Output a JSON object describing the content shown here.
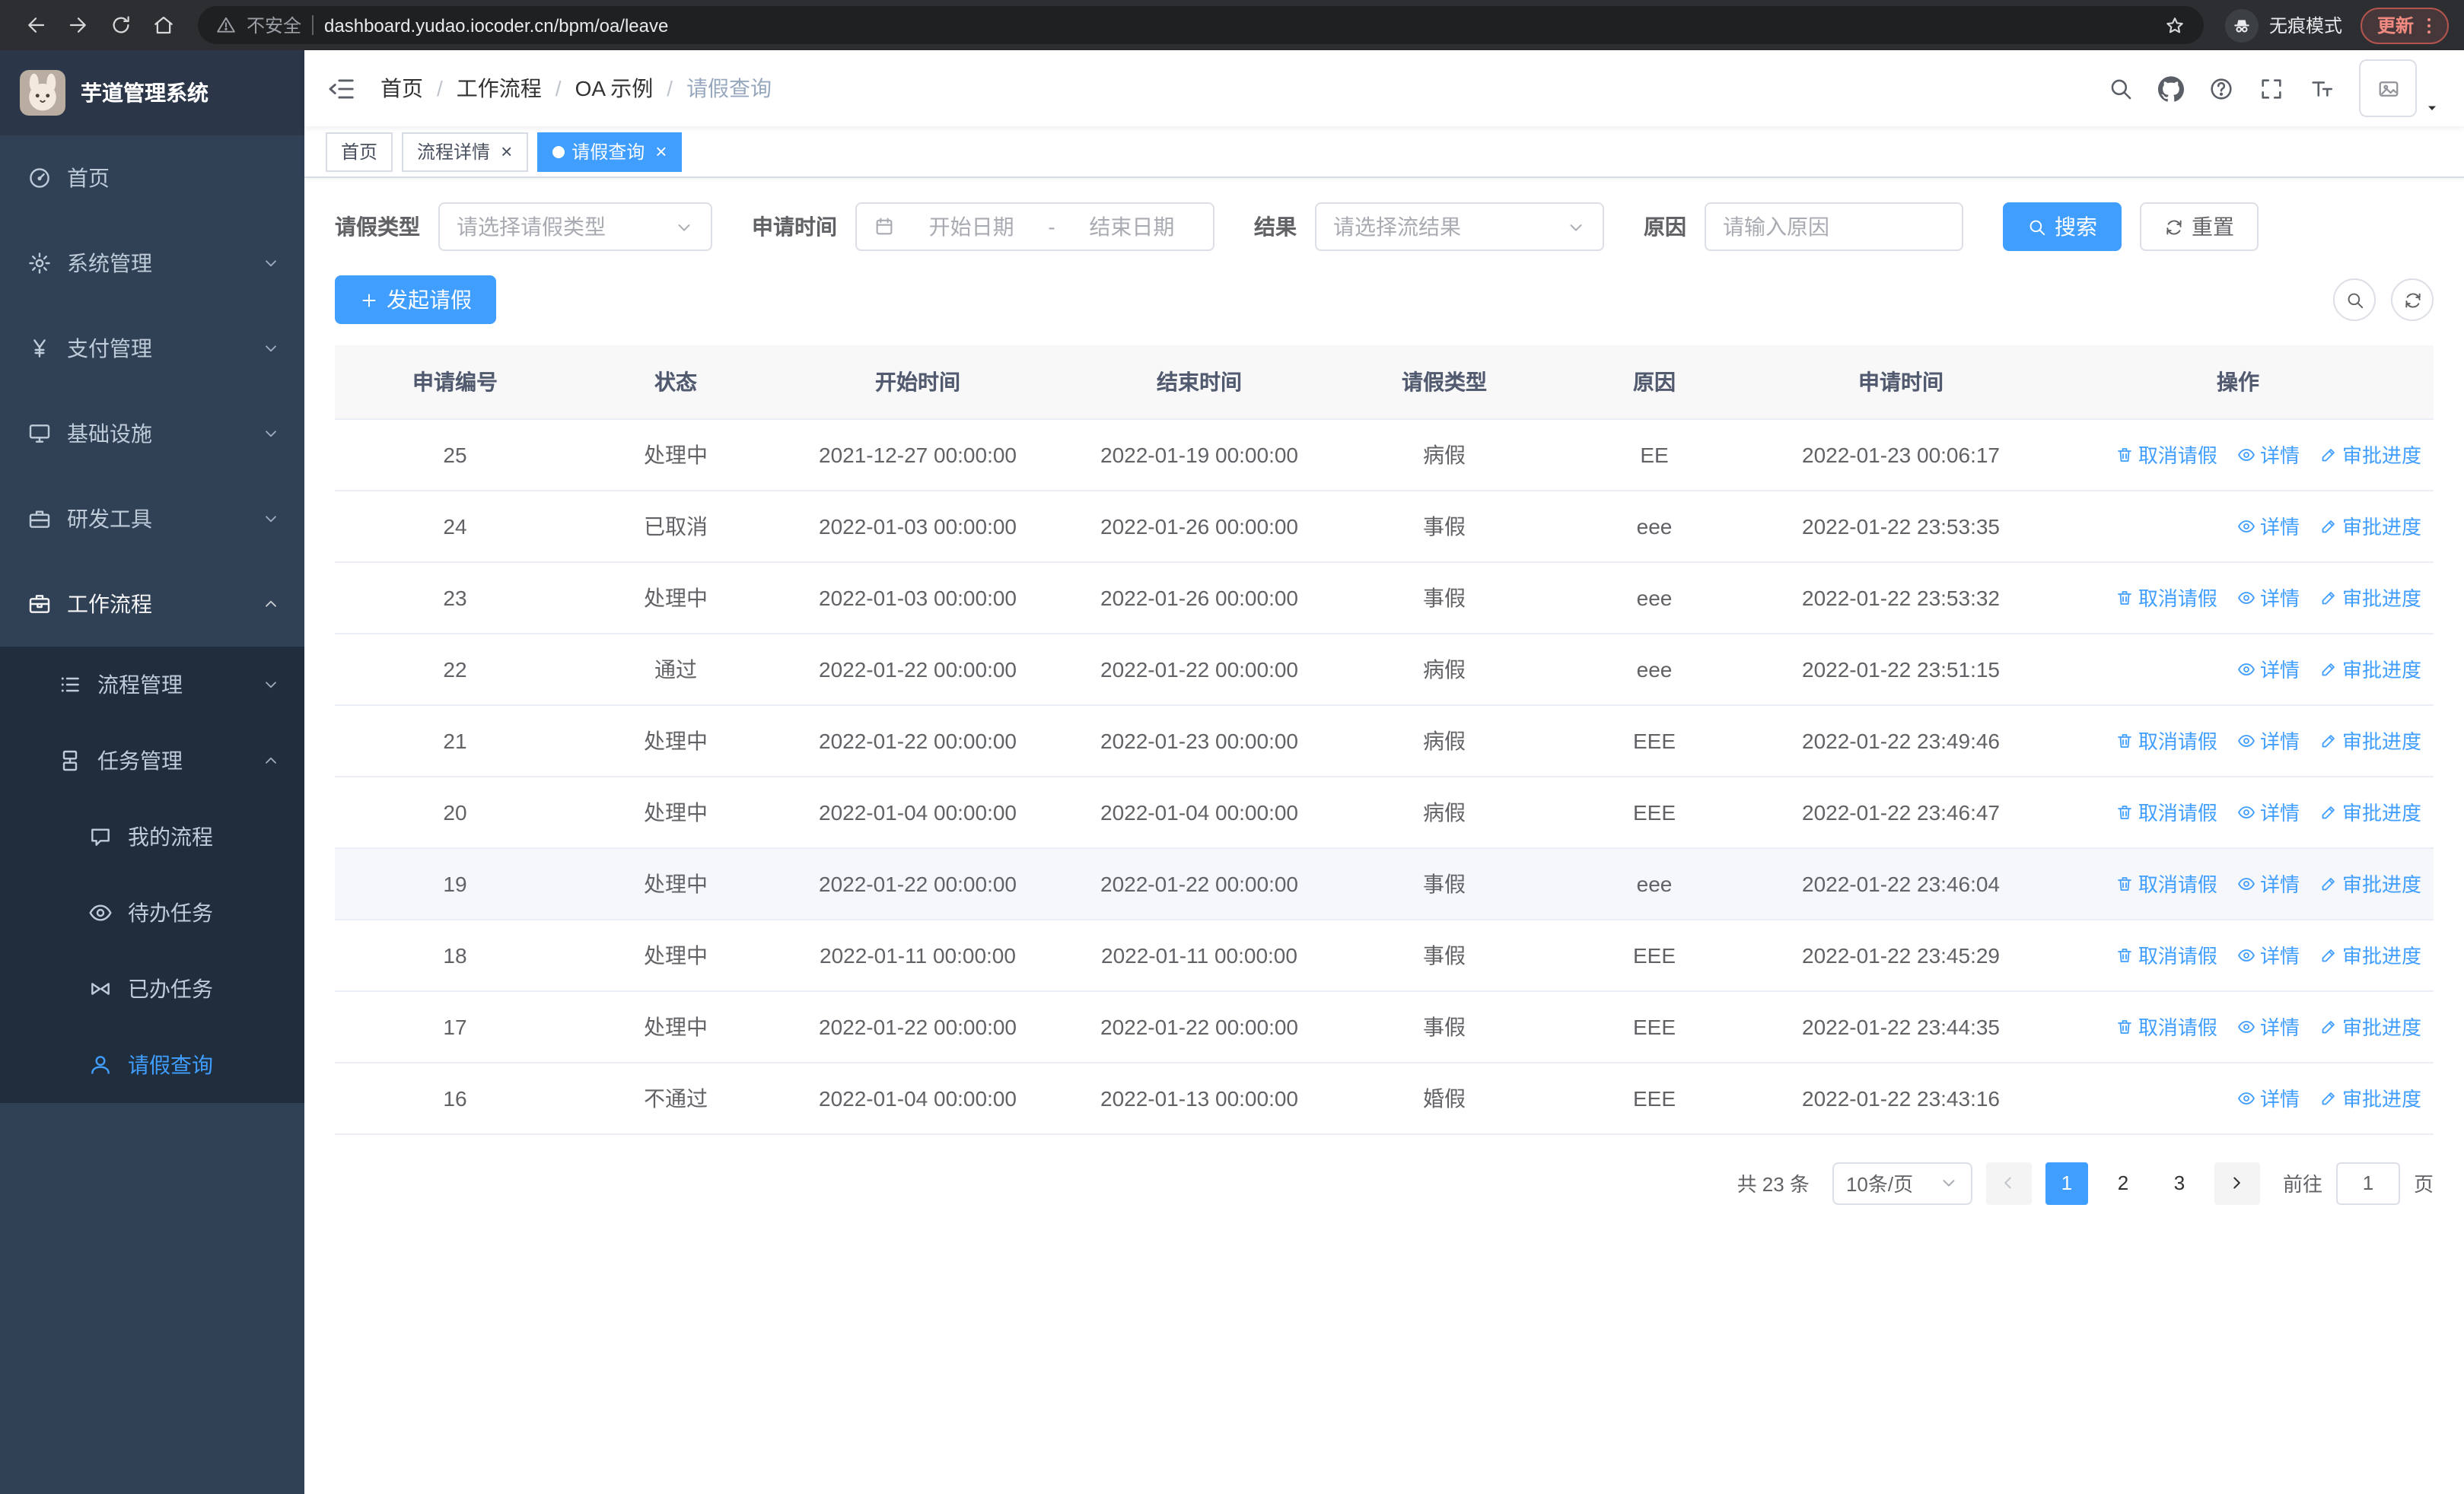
{
  "browser": {
    "security_label": "不安全",
    "url": "dashboard.yudao.iocoder.cn/bpm/oa/leave",
    "incognito_label": "无痕模式",
    "update_label": "更新"
  },
  "header": {
    "logo_title": "芋道管理系统",
    "breadcrumb": [
      "首页",
      "工作流程",
      "OA 示例",
      "请假查询"
    ]
  },
  "tabs": [
    {
      "label": "首页",
      "closable": false,
      "active": false
    },
    {
      "label": "流程详情",
      "closable": true,
      "active": false
    },
    {
      "label": "请假查询",
      "closable": true,
      "active": true
    }
  ],
  "sidebar": {
    "items": [
      {
        "label": "首页",
        "icon": "dashboard-icon",
        "level": 1
      },
      {
        "label": "系统管理",
        "icon": "gear-icon",
        "level": 1,
        "chevron": "down"
      },
      {
        "label": "支付管理",
        "icon": "yen-icon",
        "level": 1,
        "chevron": "down"
      },
      {
        "label": "基础设施",
        "icon": "monitor-icon",
        "level": 1,
        "chevron": "down"
      },
      {
        "label": "研发工具",
        "icon": "toolbox-icon",
        "level": 1,
        "chevron": "down"
      },
      {
        "label": "工作流程",
        "icon": "briefcase-icon",
        "level": 1,
        "chevron": "up",
        "open": true
      },
      {
        "label": "流程管理",
        "icon": "list-icon",
        "level": 2,
        "chevron": "down",
        "sub": true
      },
      {
        "label": "任务管理",
        "icon": "org-icon",
        "level": 2,
        "chevron": "up",
        "sub": true
      },
      {
        "label": "我的流程",
        "icon": "chat-icon",
        "level": 3,
        "sub": true
      },
      {
        "label": "待办任务",
        "icon": "eye-icon",
        "level": 3,
        "sub": true
      },
      {
        "label": "已办任务",
        "icon": "bowtie-icon",
        "level": 3,
        "sub": true
      },
      {
        "label": "请假查询",
        "icon": "user-icon",
        "level": 3,
        "sub": true,
        "active": true
      }
    ]
  },
  "filters": {
    "leave_type_label": "请假类型",
    "leave_type_placeholder": "请选择请假类型",
    "apply_time_label": "申请时间",
    "start_date_placeholder": "开始日期",
    "range_separator": "-",
    "end_date_placeholder": "结束日期",
    "result_label": "结果",
    "result_placeholder": "请选择流结果",
    "reason_label": "原因",
    "reason_placeholder": "请输入原因",
    "search_button": "搜索",
    "reset_button": "重置"
  },
  "toolbar": {
    "create_button": "发起请假"
  },
  "table": {
    "columns": [
      "申请编号",
      "状态",
      "开始时间",
      "结束时间",
      "请假类型",
      "原因",
      "申请时间",
      "操作"
    ],
    "actions": {
      "cancel": "取消请假",
      "detail": "详情",
      "progress": "审批进度"
    },
    "action_icons": {
      "cancel": "trash-icon",
      "detail": "eye-icon",
      "progress": "edit-icon"
    },
    "rows": [
      {
        "id": "25",
        "status": "处理中",
        "start": "2021-12-27 00:00:00",
        "end": "2022-01-19 00:00:00",
        "type": "病假",
        "reason": "EE",
        "applied": "2022-01-23 00:06:17",
        "actions": [
          "cancel",
          "detail",
          "progress"
        ],
        "highlight": false
      },
      {
        "id": "24",
        "status": "已取消",
        "start": "2022-01-03 00:00:00",
        "end": "2022-01-26 00:00:00",
        "type": "事假",
        "reason": "eee",
        "applied": "2022-01-22 23:53:35",
        "actions": [
          "detail",
          "progress"
        ],
        "highlight": false
      },
      {
        "id": "23",
        "status": "处理中",
        "start": "2022-01-03 00:00:00",
        "end": "2022-01-26 00:00:00",
        "type": "事假",
        "reason": "eee",
        "applied": "2022-01-22 23:53:32",
        "actions": [
          "cancel",
          "detail",
          "progress"
        ],
        "highlight": false
      },
      {
        "id": "22",
        "status": "通过",
        "start": "2022-01-22 00:00:00",
        "end": "2022-01-22 00:00:00",
        "type": "病假",
        "reason": "eee",
        "applied": "2022-01-22 23:51:15",
        "actions": [
          "detail",
          "progress"
        ],
        "highlight": false
      },
      {
        "id": "21",
        "status": "处理中",
        "start": "2022-01-22 00:00:00",
        "end": "2022-01-23 00:00:00",
        "type": "病假",
        "reason": "EEE",
        "applied": "2022-01-22 23:49:46",
        "actions": [
          "cancel",
          "detail",
          "progress"
        ],
        "highlight": false
      },
      {
        "id": "20",
        "status": "处理中",
        "start": "2022-01-04 00:00:00",
        "end": "2022-01-04 00:00:00",
        "type": "病假",
        "reason": "EEE",
        "applied": "2022-01-22 23:46:47",
        "actions": [
          "cancel",
          "detail",
          "progress"
        ],
        "highlight": false
      },
      {
        "id": "19",
        "status": "处理中",
        "start": "2022-01-22 00:00:00",
        "end": "2022-01-22 00:00:00",
        "type": "事假",
        "reason": "eee",
        "applied": "2022-01-22 23:46:04",
        "actions": [
          "cancel",
          "detail",
          "progress"
        ],
        "highlight": true
      },
      {
        "id": "18",
        "status": "处理中",
        "start": "2022-01-11 00:00:00",
        "end": "2022-01-11 00:00:00",
        "type": "事假",
        "reason": "EEE",
        "applied": "2022-01-22 23:45:29",
        "actions": [
          "cancel",
          "detail",
          "progress"
        ],
        "highlight": false
      },
      {
        "id": "17",
        "status": "处理中",
        "start": "2022-01-22 00:00:00",
        "end": "2022-01-22 00:00:00",
        "type": "事假",
        "reason": "EEE",
        "applied": "2022-01-22 23:44:35",
        "actions": [
          "cancel",
          "detail",
          "progress"
        ],
        "highlight": false
      },
      {
        "id": "16",
        "status": "不通过",
        "start": "2022-01-04 00:00:00",
        "end": "2022-01-13 00:00:00",
        "type": "婚假",
        "reason": "EEE",
        "applied": "2022-01-22 23:43:16",
        "actions": [
          "detail",
          "progress"
        ],
        "highlight": false
      }
    ]
  },
  "pagination": {
    "total_label": "共 23 条",
    "page_size": "10条/页",
    "pages": [
      "1",
      "2",
      "3"
    ],
    "active_page": "1",
    "goto_label": "前往",
    "goto_value": "1",
    "page_label": "页"
  },
  "colors": {
    "accent": "#409eff",
    "sidebar_bg": "#304156",
    "submenu_bg": "#1f2d3d",
    "chrome_bg": "#2d2e31"
  }
}
